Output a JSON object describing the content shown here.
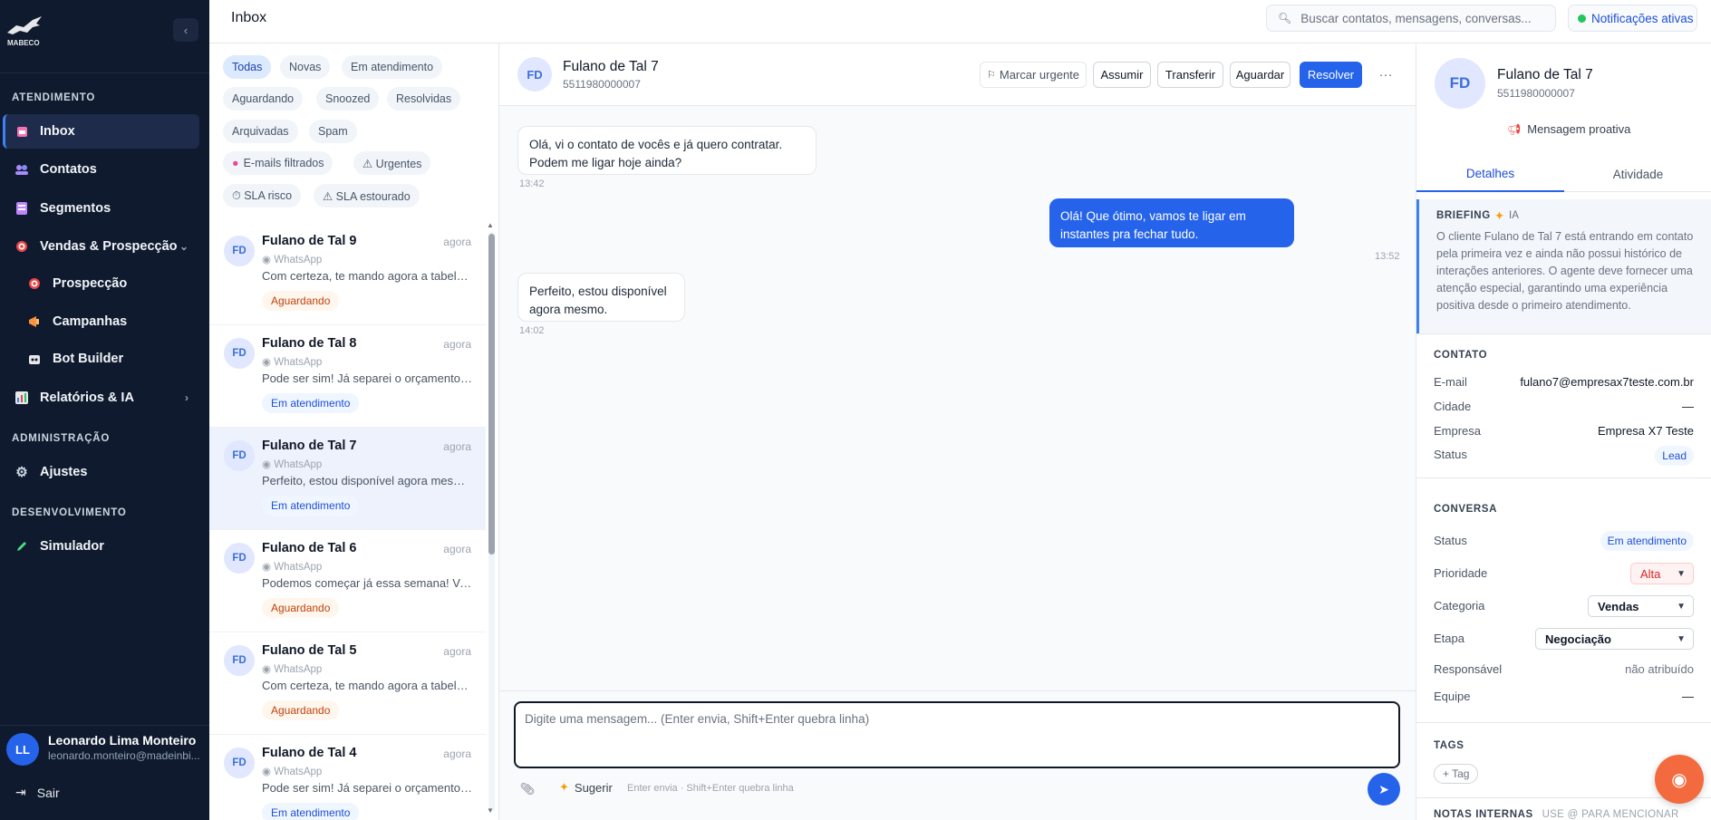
{
  "app": {
    "page_title": "Inbox",
    "search_placeholder": "Buscar contatos, mensagens, conversas...",
    "notifications_label": "Notificações ativas"
  },
  "sidebar": {
    "sections": {
      "atendimento": "ATENDIMENTO",
      "administracao": "ADMINISTRAÇÃO",
      "desenvolvimento": "DESENVOLVIMENTO"
    },
    "items": [
      {
        "label": "Inbox",
        "icon": "inbox-icon"
      },
      {
        "label": "Contatos",
        "icon": "users-icon"
      },
      {
        "label": "Segmentos",
        "icon": "segments-icon"
      },
      {
        "label": "Vendas & Prospecção",
        "icon": "target-icon"
      },
      {
        "label": "Prospecção",
        "icon": "target-icon"
      },
      {
        "label": "Campanhas",
        "icon": "megaphone-icon"
      },
      {
        "label": "Bot Builder",
        "icon": "bot-icon"
      },
      {
        "label": "Relatórios & IA",
        "icon": "chart-icon"
      },
      {
        "label": "Ajustes",
        "icon": "gear-icon"
      },
      {
        "label": "Simulador",
        "icon": "pencil-icon"
      }
    ],
    "user": {
      "initials": "LL",
      "name": "Leonardo Lima Monteiro",
      "email": "leonardo.monteiro@madeinbi..."
    },
    "logout_label": "Sair"
  },
  "filters": [
    "Todas",
    "Novas",
    "Em atendimento",
    "Aguardando",
    "Snoozed",
    "Resolvidas",
    "Arquivadas",
    "Spam",
    "E-mails filtrados",
    "⚠ Urgentes",
    "⏱ SLA risco",
    "⚠ SLA estourado"
  ],
  "conversations": [
    {
      "initials": "FD",
      "name": "Fulano de Tal 9",
      "time": "agora",
      "channel": "◉ WhatsApp",
      "preview": "Com certeza, te mando agora a tabela e...",
      "status": "Aguardando"
    },
    {
      "initials": "FD",
      "name": "Fulano de Tal 8",
      "time": "agora",
      "channel": "◉ WhatsApp",
      "preview": "Pode ser sim! Já separei o orçamento, s...",
      "status": "Em atendimento"
    },
    {
      "initials": "FD",
      "name": "Fulano de Tal 7",
      "time": "agora",
      "channel": "◉ WhatsApp",
      "preview": "Perfeito, estou disponível agora mesmo.",
      "status": "Em atendimento"
    },
    {
      "initials": "FD",
      "name": "Fulano de Tal 6",
      "time": "agora",
      "channel": "◉ WhatsApp",
      "preview": "Podemos começar já essa semana! Vou ...",
      "status": "Aguardando"
    },
    {
      "initials": "FD",
      "name": "Fulano de Tal 5",
      "time": "agora",
      "channel": "◉ WhatsApp",
      "preview": "Com certeza, te mando agora a tabela e...",
      "status": "Aguardando"
    },
    {
      "initials": "FD",
      "name": "Fulano de Tal 4",
      "time": "agora",
      "channel": "◉ WhatsApp",
      "preview": "Pode ser sim! Já separei o orçamento, s...",
      "status": "Em atendimento"
    }
  ],
  "chat": {
    "contact_initials": "FD",
    "contact_name": "Fulano de Tal 7",
    "contact_phone": "5511980000007",
    "actions": {
      "urgent": "Marcar urgente",
      "assume": "Assumir",
      "transfer": "Transferir",
      "wait": "Aguardar",
      "resolve": "Resolver"
    },
    "messages": [
      {
        "direction": "in",
        "text_line1": "Olá, vi o contato de vocês e já quero contratar.",
        "text_line2": "Podem me ligar hoje ainda?",
        "time": "13:42"
      },
      {
        "direction": "out",
        "text_line1": "Olá! Que ótimo, vamos te ligar em",
        "text_line2": "instantes pra fechar tudo.",
        "time": "13:52"
      },
      {
        "direction": "in",
        "text_line1": "Perfeito, estou disponível",
        "text_line2": "agora mesmo.",
        "time": "14:02"
      }
    ],
    "composer_placeholder": "Digite uma mensagem... (Enter envia, Shift+Enter quebra linha)",
    "suggest_label": "Sugerir",
    "hint": "Enter envia · Shift+Enter quebra linha"
  },
  "details": {
    "initials": "FD",
    "name": "Fulano de Tal 7",
    "phone": "5511980000007",
    "proactive_label": "Mensagem proativa",
    "tabs": [
      "Detalhes",
      "Atividade"
    ],
    "briefing_title": "BRIEFING",
    "briefing_tag": "IA",
    "briefing_text": "O cliente Fulano de Tal 7 está entrando em contato pela primeira vez e ainda não possui histórico de interações anteriores. O agente deve fornecer uma atenção especial, garantindo uma experiência positiva desde o primeiro atendimento.",
    "contact_section": "CONTATO",
    "contact": {
      "email_label": "E-mail",
      "email": "fulano7@empresax7teste.com.br",
      "city_label": "Cidade",
      "city": "—",
      "company_label": "Empresa",
      "company": "Empresa X7 Teste",
      "status_label": "Status",
      "status": "Lead"
    },
    "conversation_section": "CONVERSA",
    "conversation": {
      "status_label": "Status",
      "status": "Em atendimento",
      "priority_label": "Prioridade",
      "priority": "Alta",
      "category_label": "Categoria",
      "category": "Vendas",
      "stage_label": "Etapa",
      "stage": "Negociação",
      "owner_label": "Responsável",
      "owner": "não atribuído",
      "team_label": "Equipe",
      "team": "—"
    },
    "tags_section": "TAGS",
    "add_tag": "+ Tag",
    "notes_title": "NOTAS INTERNAS",
    "notes_hint": "USE @ PARA MENCIONAR"
  },
  "colors": {
    "sidebar_bg": "#0f1a2e",
    "accent": "#2563eb",
    "status_online": "#22c55e",
    "fab": "#f26a3d"
  }
}
